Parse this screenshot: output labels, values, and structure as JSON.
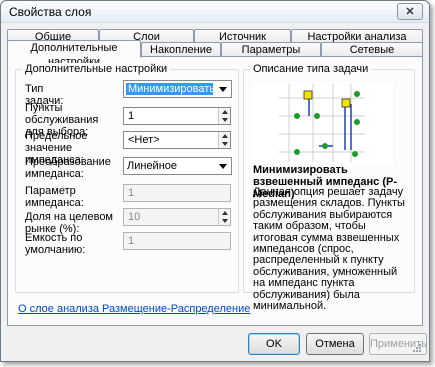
{
  "window": {
    "title": "Свойства слоя",
    "close_glyph": "✕"
  },
  "tabs_row1": [
    {
      "label": "Общие"
    },
    {
      "label": "Слои"
    },
    {
      "label": "Источник"
    },
    {
      "label": "Настройки анализа"
    }
  ],
  "tabs_row2": [
    {
      "label": "Дополнительные настройки",
      "active": true
    },
    {
      "label": "Накопление"
    },
    {
      "label": "Параметры атрибута"
    },
    {
      "label": "Сетевые положения"
    }
  ],
  "settings": {
    "legend": "Дополнительные настройки",
    "problem_type": {
      "label": "Тип задачи:",
      "value": "Минимизировать импеда"
    },
    "facilities": {
      "label": "Пункты обслуживания для выбора:",
      "value": "1"
    },
    "impedance_cutoff": {
      "label": "Предельное значение импеданса:",
      "value": "<Нет>"
    },
    "impedance_transform": {
      "label": "Преобразование импеданса:",
      "value": "Линейное"
    },
    "impedance_param": {
      "label": "Параметр импеданса:",
      "value": "1"
    },
    "target_share": {
      "label": "Доля на целевом рынке (%):",
      "value": "10"
    },
    "default_capacity": {
      "label": "Емкость по умолчанию:",
      "value": "1"
    }
  },
  "description": {
    "legend": "Описание типа задачи",
    "title": "Минимизировать взвешенный импеданс (P-Median)",
    "body": "Данная опция решает задачу размещения складов. Пункты обслуживания выбираются таким образом, чтобы итоговая сумма взвешенных импедансов (спрос, распределенный к пункту обслуживания, умноженный на импеданс пункта обслуживания) была минимальной."
  },
  "link": "О слое анализа Размещение-Распределение",
  "buttons": {
    "ok": "OK",
    "cancel": "Отмена",
    "apply": "Применить"
  },
  "colors": {
    "accent_blue": "#0046d5",
    "facility_yellow": "#f4e300",
    "demand_green": "#1e9b2b",
    "route_blue": "#1f3fbf"
  }
}
